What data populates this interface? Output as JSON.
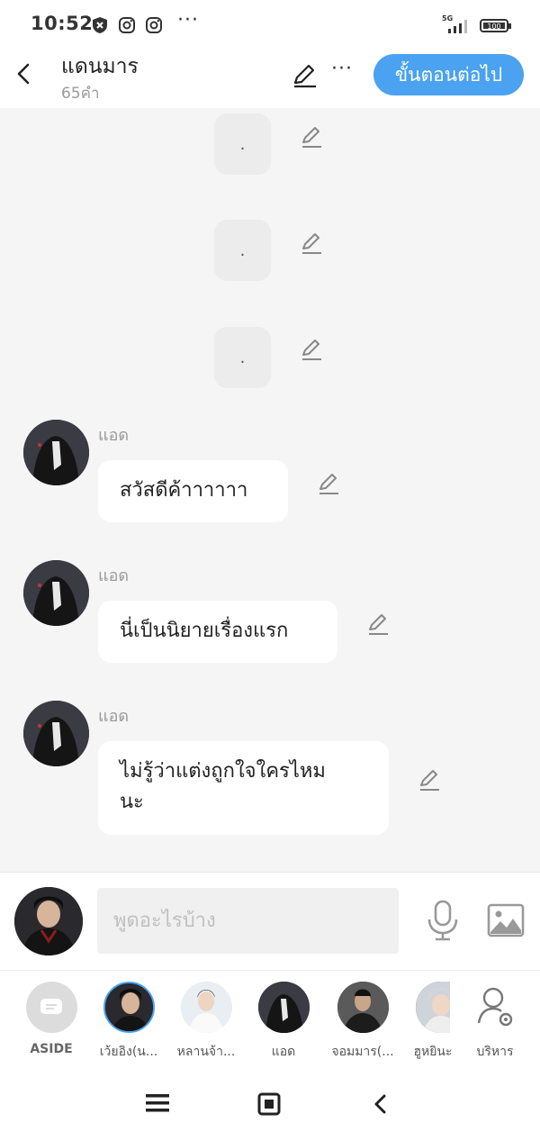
{
  "status_bar": {
    "time": "10:52",
    "network": "5G",
    "battery": "100"
  },
  "header": {
    "title": "แดนมาร",
    "subtitle": "65คำ",
    "next_label": "ขั้นตอนต่อไป"
  },
  "chat": {
    "placeholders": [
      ".",
      ".",
      "."
    ],
    "messages": [
      {
        "sender": "แอด",
        "text": "สวัสดีค้าาาาาา"
      },
      {
        "sender": "แอด",
        "text": "นี่เป็นนิยายเรื่องแรก"
      },
      {
        "sender": "แอด",
        "text": "ไม่รู้ว่าแต่งถูกใจใครไหม\nนะ"
      }
    ]
  },
  "input": {
    "placeholder": "พูดอะไรบ้าง"
  },
  "characters": [
    {
      "name": "ASIDE"
    },
    {
      "name": "เว้ยอิง(น..."
    },
    {
      "name": "หลานจ้า..."
    },
    {
      "name": "แอด"
    },
    {
      "name": "จอมมาร(..."
    },
    {
      "name": "ฮูหยินะ"
    },
    {
      "name": "บริหาร"
    }
  ],
  "colors": {
    "accent": "#4aa2f0",
    "background": "#f5f5f5",
    "bubble": "#ffffff"
  }
}
